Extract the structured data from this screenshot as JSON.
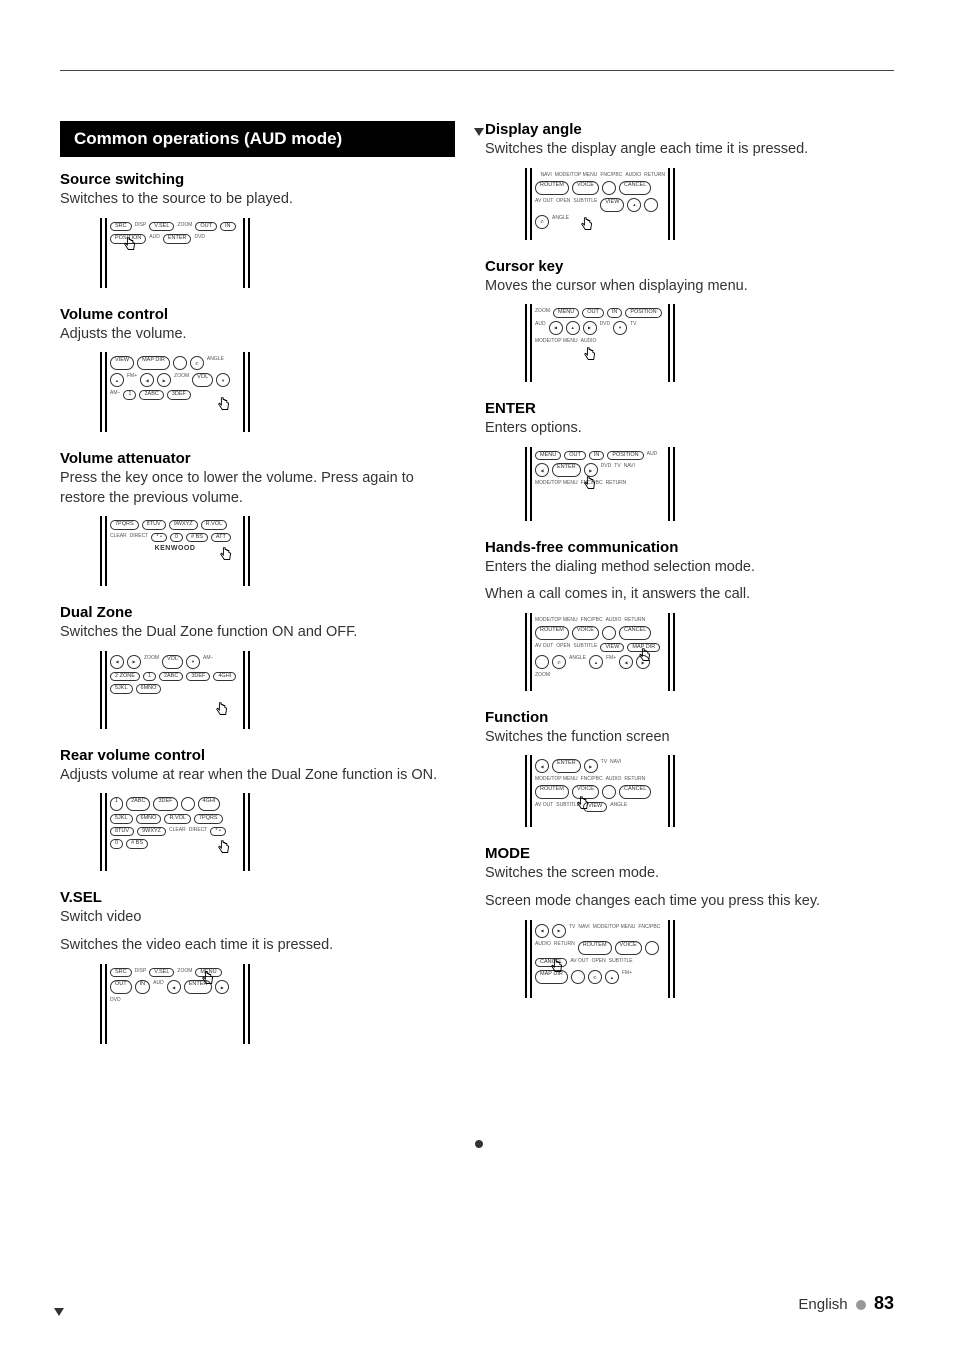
{
  "header": {
    "title": "Common operations (AUD mode)"
  },
  "left": {
    "source_switching": {
      "title": "Source switching",
      "desc": "Switches to the source to be played."
    },
    "volume_control": {
      "title": "Volume control",
      "desc": "Adjusts the volume."
    },
    "volume_attenuator": {
      "title": "Volume attenuator",
      "desc": "Press the key once to lower the volume. Press again to restore the previous volume."
    },
    "dual_zone": {
      "title": "Dual Zone",
      "desc": "Switches the Dual Zone function ON and OFF."
    },
    "rear_volume": {
      "title": "Rear volume control",
      "desc": "Adjusts volume at rear when the Dual Zone function is ON."
    },
    "vsel": {
      "title": "V.SEL",
      "desc1": "Switch video",
      "desc2": "Switches the video each time it is pressed."
    }
  },
  "right": {
    "display_angle": {
      "title": "Display angle",
      "desc": "Switches the display angle each time it is pressed."
    },
    "cursor_key": {
      "title": "Cursor key",
      "desc": "Moves the cursor when displaying menu."
    },
    "enter": {
      "title": "ENTER",
      "desc": "Enters options."
    },
    "hands_free": {
      "title": "Hands-free communication",
      "desc1": "Enters the dialing method selection mode.",
      "desc2": "When a call comes in, it answers the call."
    },
    "function": {
      "title": "Function",
      "desc": "Switches the function screen"
    },
    "mode": {
      "title": "MODE",
      "desc1": "Switches the screen mode.",
      "desc2": "Screen mode changes each time you press this key."
    }
  },
  "remote": {
    "buttons": {
      "src": "SRC",
      "disp": "DISP",
      "vsel": "V.SEL",
      "menu": "MENU",
      "out": "OUT",
      "in": "IN",
      "position": "POSITION",
      "enter": "ENTER",
      "view": "VIEW",
      "map_dir": "MAP DIR",
      "router": "ROUTEM",
      "voice": "VOICE",
      "cancel": "CANCEL",
      "open": "OPEN",
      "subtitle": "SUBTITLE",
      "audio": "AUDIO",
      "return": "RETURN",
      "av_out": "AV OUT",
      "angle": "ANGLE",
      "zoom": "ZOOM",
      "aud": "AUD",
      "dvd": "DVD",
      "tv": "TV",
      "navi": "NAVI",
      "vol": "VOL",
      "rvol": "R.VOL",
      "2zone": "2 ZONE",
      "clear": "CLEAR",
      "direct": "DIRECT",
      "att": "ATT",
      "fm_plus": "FM+",
      "am_minus": "AM−",
      "mode_top_menu": "MODE/TOP MENU",
      "fnc_pbc": "FNC/PBC",
      "num1": "1",
      "num2": "2ABC",
      "num3": "3DEF",
      "num4": "4GHI",
      "num5": "5JKL",
      "num6": "6MNO",
      "num7": "7PQRS",
      "num8": "8TUV",
      "num9": "9WXYZ",
      "num0": "0",
      "star": "* •",
      "hash": "# BS",
      "kenwood": "KENWOOD",
      "phone_on": "phone-on-icon",
      "phone_off": "phone-off-icon"
    }
  },
  "footer": {
    "lang": "English",
    "page": "83"
  }
}
